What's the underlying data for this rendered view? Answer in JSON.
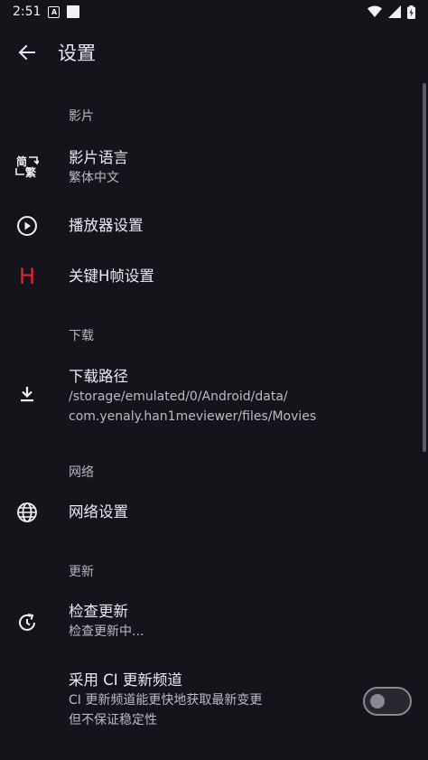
{
  "status_bar": {
    "time": "2:51",
    "a_icon_label": "A"
  },
  "app_bar": {
    "title": "设置"
  },
  "sections": {
    "video": {
      "header": "影片"
    },
    "download": {
      "header": "下载"
    },
    "network": {
      "header": "网络"
    },
    "update": {
      "header": "更新"
    }
  },
  "items": {
    "video_language": {
      "title": "影片语言",
      "subtitle": "繁体中文",
      "icon_text_a": "简",
      "icon_text_b": "繁"
    },
    "player_settings": {
      "title": "播放器设置"
    },
    "h_keyframe": {
      "title": "关键H帧设置",
      "icon_text": "H"
    },
    "download_path": {
      "title": "下载路径",
      "subtitle_line1": "/storage/emulated/0/Android/data/",
      "subtitle_line2": "com.yenaly.han1meviewer/files/Movies"
    },
    "network_settings": {
      "title": "网络设置"
    },
    "check_update": {
      "title": "检查更新",
      "subtitle": "检查更新中..."
    },
    "ci_channel": {
      "title": "采用 CI 更新频道",
      "subtitle_line1": "CI 更新频道能更快地获取最新变更",
      "subtitle_line2": "但不保证稳定性",
      "enabled": false
    }
  },
  "colors": {
    "background": "#16141b",
    "accent_h": "#e0262f"
  }
}
